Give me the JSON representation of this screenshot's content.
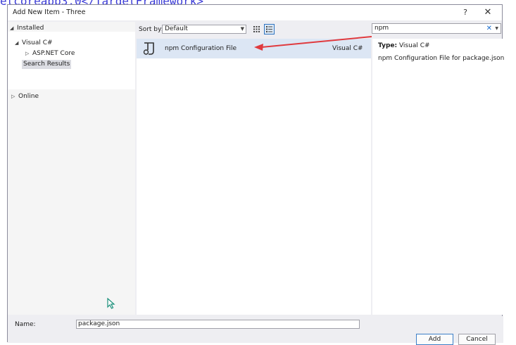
{
  "background": {
    "code_text": "etcoreapp3.0</TargetFramework>"
  },
  "dialog": {
    "title": "Add New Item - Three",
    "help_glyph": "?",
    "close_glyph": "✕"
  },
  "tree": {
    "installed": "Installed",
    "visual_csharp": "Visual C#",
    "asp_net_core": "ASP.NET Core",
    "search_results": "Search Results",
    "online": "Online"
  },
  "toolbar": {
    "sort_label": "Sort by:",
    "sort_value": "Default",
    "search_value": "npm",
    "clear_glyph": "✕"
  },
  "items": [
    {
      "name": "npm Configuration File",
      "language": "Visual C#",
      "icon": "npm-file-icon"
    }
  ],
  "details": {
    "type_label": "Type:",
    "type_value": "Visual C#",
    "description": "npm Configuration File for package.json"
  },
  "footer": {
    "name_label": "Name:",
    "name_value": "package.json",
    "add_label": "Add",
    "cancel_label": "Cancel"
  },
  "colors": {
    "accent": "#2f74c0",
    "selection": "#dce6f4",
    "annotation_arrow": "#e03a3e"
  }
}
